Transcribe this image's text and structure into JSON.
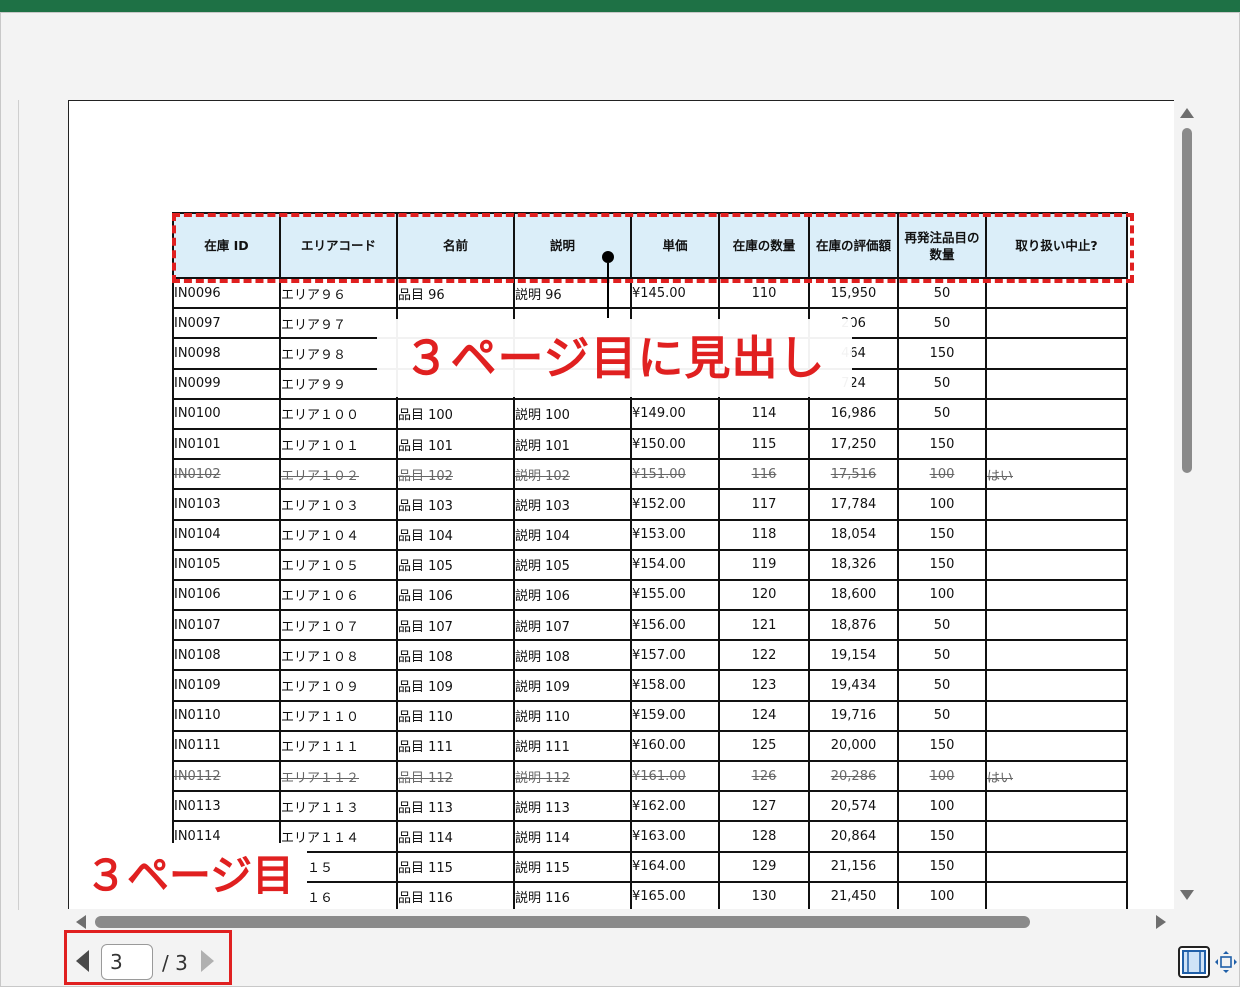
{
  "sheet": {
    "headers": [
      "在庫 ID",
      "エリアコード",
      "名前",
      "説明",
      "単価",
      "在庫の数量",
      "在庫の評価額",
      "再発注品目の数量",
      "取り扱い中止?"
    ],
    "rows": [
      {
        "id": "IN0096",
        "area": "エリア９６",
        "name": "品目 96",
        "desc": "説明 96",
        "price": "¥145.00",
        "qty": "110",
        "value": "15,950",
        "reorder": "50",
        "disc": "",
        "struck": false
      },
      {
        "id": "IN0097",
        "area": "エリア９７",
        "name": "",
        "desc": "",
        "price": "",
        "qty": "",
        "value": "206",
        "reorder": "50",
        "disc": "",
        "struck": false
      },
      {
        "id": "IN0098",
        "area": "エリア９８",
        "name": "",
        "desc": "",
        "price": "",
        "qty": "",
        "value": "464",
        "reorder": "150",
        "disc": "",
        "struck": false
      },
      {
        "id": "IN0099",
        "area": "エリア９９",
        "name": "",
        "desc": "",
        "price": "",
        "qty": "",
        "value": "724",
        "reorder": "50",
        "disc": "",
        "struck": false
      },
      {
        "id": "IN0100",
        "area": "エリア１００",
        "name": "品目 100",
        "desc": "説明 100",
        "price": "¥149.00",
        "qty": "114",
        "value": "16,986",
        "reorder": "50",
        "disc": "",
        "struck": false
      },
      {
        "id": "IN0101",
        "area": "エリア１０１",
        "name": "品目 101",
        "desc": "説明 101",
        "price": "¥150.00",
        "qty": "115",
        "value": "17,250",
        "reorder": "150",
        "disc": "",
        "struck": false
      },
      {
        "id": "IN0102",
        "area": "エリア１０２",
        "name": "品目 102",
        "desc": "説明 102",
        "price": "¥151.00",
        "qty": "116",
        "value": "17,516",
        "reorder": "100",
        "disc": "はい",
        "struck": true
      },
      {
        "id": "IN0103",
        "area": "エリア１０３",
        "name": "品目 103",
        "desc": "説明 103",
        "price": "¥152.00",
        "qty": "117",
        "value": "17,784",
        "reorder": "100",
        "disc": "",
        "struck": false
      },
      {
        "id": "IN0104",
        "area": "エリア１０４",
        "name": "品目 104",
        "desc": "説明 104",
        "price": "¥153.00",
        "qty": "118",
        "value": "18,054",
        "reorder": "150",
        "disc": "",
        "struck": false
      },
      {
        "id": "IN0105",
        "area": "エリア１０５",
        "name": "品目 105",
        "desc": "説明 105",
        "price": "¥154.00",
        "qty": "119",
        "value": "18,326",
        "reorder": "150",
        "disc": "",
        "struck": false
      },
      {
        "id": "IN0106",
        "area": "エリア１０６",
        "name": "品目 106",
        "desc": "説明 106",
        "price": "¥155.00",
        "qty": "120",
        "value": "18,600",
        "reorder": "100",
        "disc": "",
        "struck": false
      },
      {
        "id": "IN0107",
        "area": "エリア１０７",
        "name": "品目 107",
        "desc": "説明 107",
        "price": "¥156.00",
        "qty": "121",
        "value": "18,876",
        "reorder": "50",
        "disc": "",
        "struck": false
      },
      {
        "id": "IN0108",
        "area": "エリア１０８",
        "name": "品目 108",
        "desc": "説明 108",
        "price": "¥157.00",
        "qty": "122",
        "value": "19,154",
        "reorder": "50",
        "disc": "",
        "struck": false
      },
      {
        "id": "IN0109",
        "area": "エリア１０９",
        "name": "品目 109",
        "desc": "説明 109",
        "price": "¥158.00",
        "qty": "123",
        "value": "19,434",
        "reorder": "50",
        "disc": "",
        "struck": false
      },
      {
        "id": "IN0110",
        "area": "エリア１１０",
        "name": "品目 110",
        "desc": "説明 110",
        "price": "¥159.00",
        "qty": "124",
        "value": "19,716",
        "reorder": "50",
        "disc": "",
        "struck": false
      },
      {
        "id": "IN0111",
        "area": "エリア１１１",
        "name": "品目 111",
        "desc": "説明 111",
        "price": "¥160.00",
        "qty": "125",
        "value": "20,000",
        "reorder": "150",
        "disc": "",
        "struck": false
      },
      {
        "id": "IN0112",
        "area": "エリア１１２",
        "name": "品目 112",
        "desc": "説明 112",
        "price": "¥161.00",
        "qty": "126",
        "value": "20,286",
        "reorder": "100",
        "disc": "はい",
        "struck": true
      },
      {
        "id": "IN0113",
        "area": "エリア１１３",
        "name": "品目 113",
        "desc": "説明 113",
        "price": "¥162.00",
        "qty": "127",
        "value": "20,574",
        "reorder": "100",
        "disc": "",
        "struck": false
      },
      {
        "id": "IN0114",
        "area": "エリア１１４",
        "name": "品目 114",
        "desc": "説明 114",
        "price": "¥163.00",
        "qty": "128",
        "value": "20,864",
        "reorder": "150",
        "disc": "",
        "struck": false
      },
      {
        "id": "",
        "area": "ア１１５",
        "name": "品目 115",
        "desc": "説明 115",
        "price": "¥164.00",
        "qty": "129",
        "value": "21,156",
        "reorder": "150",
        "disc": "",
        "struck": false
      },
      {
        "id": "",
        "area": "ア１１６",
        "name": "品目 116",
        "desc": "説明 116",
        "price": "¥165.00",
        "qty": "130",
        "value": "21,450",
        "reorder": "100",
        "disc": "",
        "struck": false
      }
    ]
  },
  "annotations": {
    "header_callout": "３ページ目に見出し",
    "page_callout": "３ページ目"
  },
  "pager": {
    "current_page": "3",
    "total_label": "/ 3"
  },
  "colors": {
    "accent_red": "#e02020",
    "header_fill": "#dbeef9",
    "excel_green": "#1e7145"
  },
  "icons": {
    "prev": "triangle-left-icon",
    "next": "triangle-right-icon",
    "normal_view": "normal-view-icon",
    "zoom_to_page": "zoom-to-page-icon"
  }
}
